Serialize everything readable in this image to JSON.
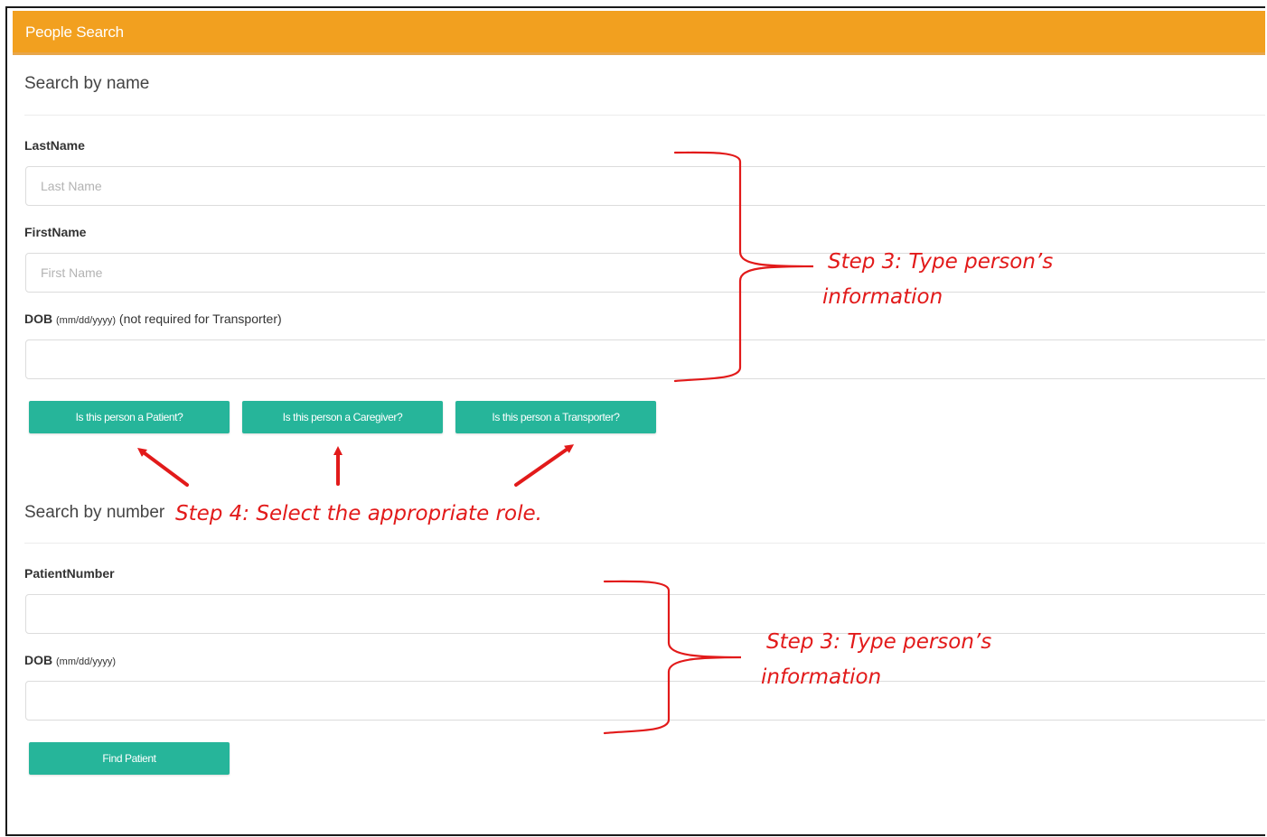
{
  "header": {
    "title": "People Search"
  },
  "name_search": {
    "title": "Search by name",
    "last_name": {
      "label": "LastName",
      "placeholder": "Last Name",
      "value": ""
    },
    "first_name": {
      "label": "FirstName",
      "placeholder": "First Name",
      "value": ""
    },
    "dob": {
      "label": "DOB",
      "format_hint": "(mm/dd/yyyy)",
      "note": "(not required for Transporter)",
      "value": ""
    },
    "role_buttons": {
      "patient": "Is this person a Patient?",
      "caregiver": "Is this person a Caregiver?",
      "transporter": "Is this person a Transporter?"
    }
  },
  "number_search": {
    "title": "Search by number",
    "patient_number": {
      "label": "PatientNumber",
      "value": ""
    },
    "dob": {
      "label": "DOB",
      "format_hint": "(mm/dd/yyyy)",
      "value": ""
    },
    "find_button": "Find Patient"
  },
  "annotations": {
    "step3_top": {
      "line1": "Step 3: Type person’s",
      "line2": "information"
    },
    "step4": "Step 4: Select the appropriate role.",
    "step3_bottom": {
      "line1": "Step 3: Type person’s",
      "line2": "information"
    },
    "color": "#e21a1a"
  },
  "colors": {
    "header": "#f2a01f",
    "button": "#26b59a"
  }
}
